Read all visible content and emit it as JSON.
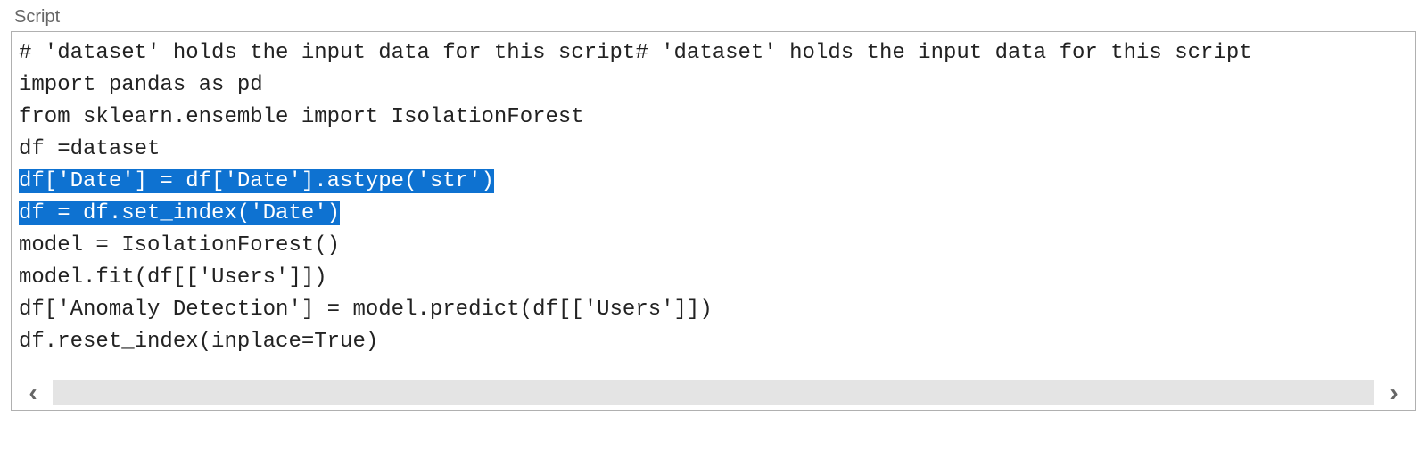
{
  "header": {
    "label": "Script"
  },
  "editor": {
    "lines": [
      "# 'dataset' holds the input data for this script# 'dataset' holds the input data for this script",
      "import pandas as pd",
      "from sklearn.ensemble import IsolationForest",
      "df =dataset",
      "df['Date'] = df['Date'].astype('str')",
      "df = df.set_index('Date')",
      "model = IsolationForest()",
      "model.fit(df[['Users']])",
      "df['Anomaly Detection'] = model.predict(df[['Users']])",
      "df.reset_index(inplace=True)"
    ],
    "selected_line_indices": [
      4,
      5
    ]
  },
  "scrollbar": {
    "left_glyph": "‹",
    "right_glyph": "›"
  }
}
